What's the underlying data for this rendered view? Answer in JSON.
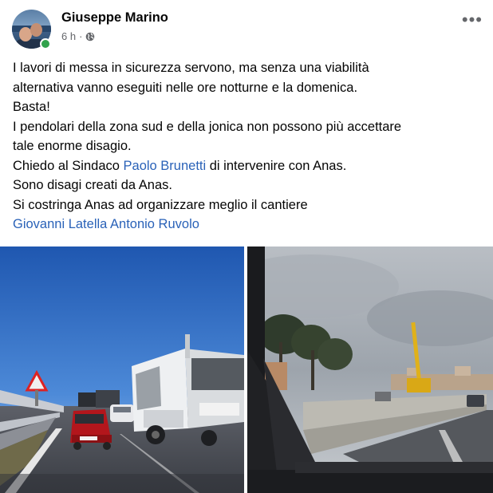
{
  "post": {
    "author": "Giuseppe Marino",
    "time": "6 h",
    "audience_icon": "globe-icon",
    "more_icon": "more-options-icon",
    "more_label": "•••",
    "lines": [
      "I lavori di messa in sicurezza servono, ma senza una viabilità",
      "alternativa vanno eseguiti nelle ore notturne e la domenica.",
      "Basta!",
      "I pendolari della zona sud e della jonica non possono più accettare",
      "tale enorme disagio."
    ],
    "line6_prefix": "Chiedo al Sindaco ",
    "line6_mention": "Paolo Brunetti",
    "line6_suffix": " di intervenire con Anas.",
    "line7": "Sono disagi creati da Anas.",
    "line8": "Si costringa Anas ad organizzare meglio il cantiere",
    "mention_1": "Giovanni Latella",
    "mention_2": "Antonio Ruvolo"
  },
  "colors": {
    "link": "#2a62b8",
    "secondary_text": "#65676b",
    "online": "#31a24c"
  }
}
